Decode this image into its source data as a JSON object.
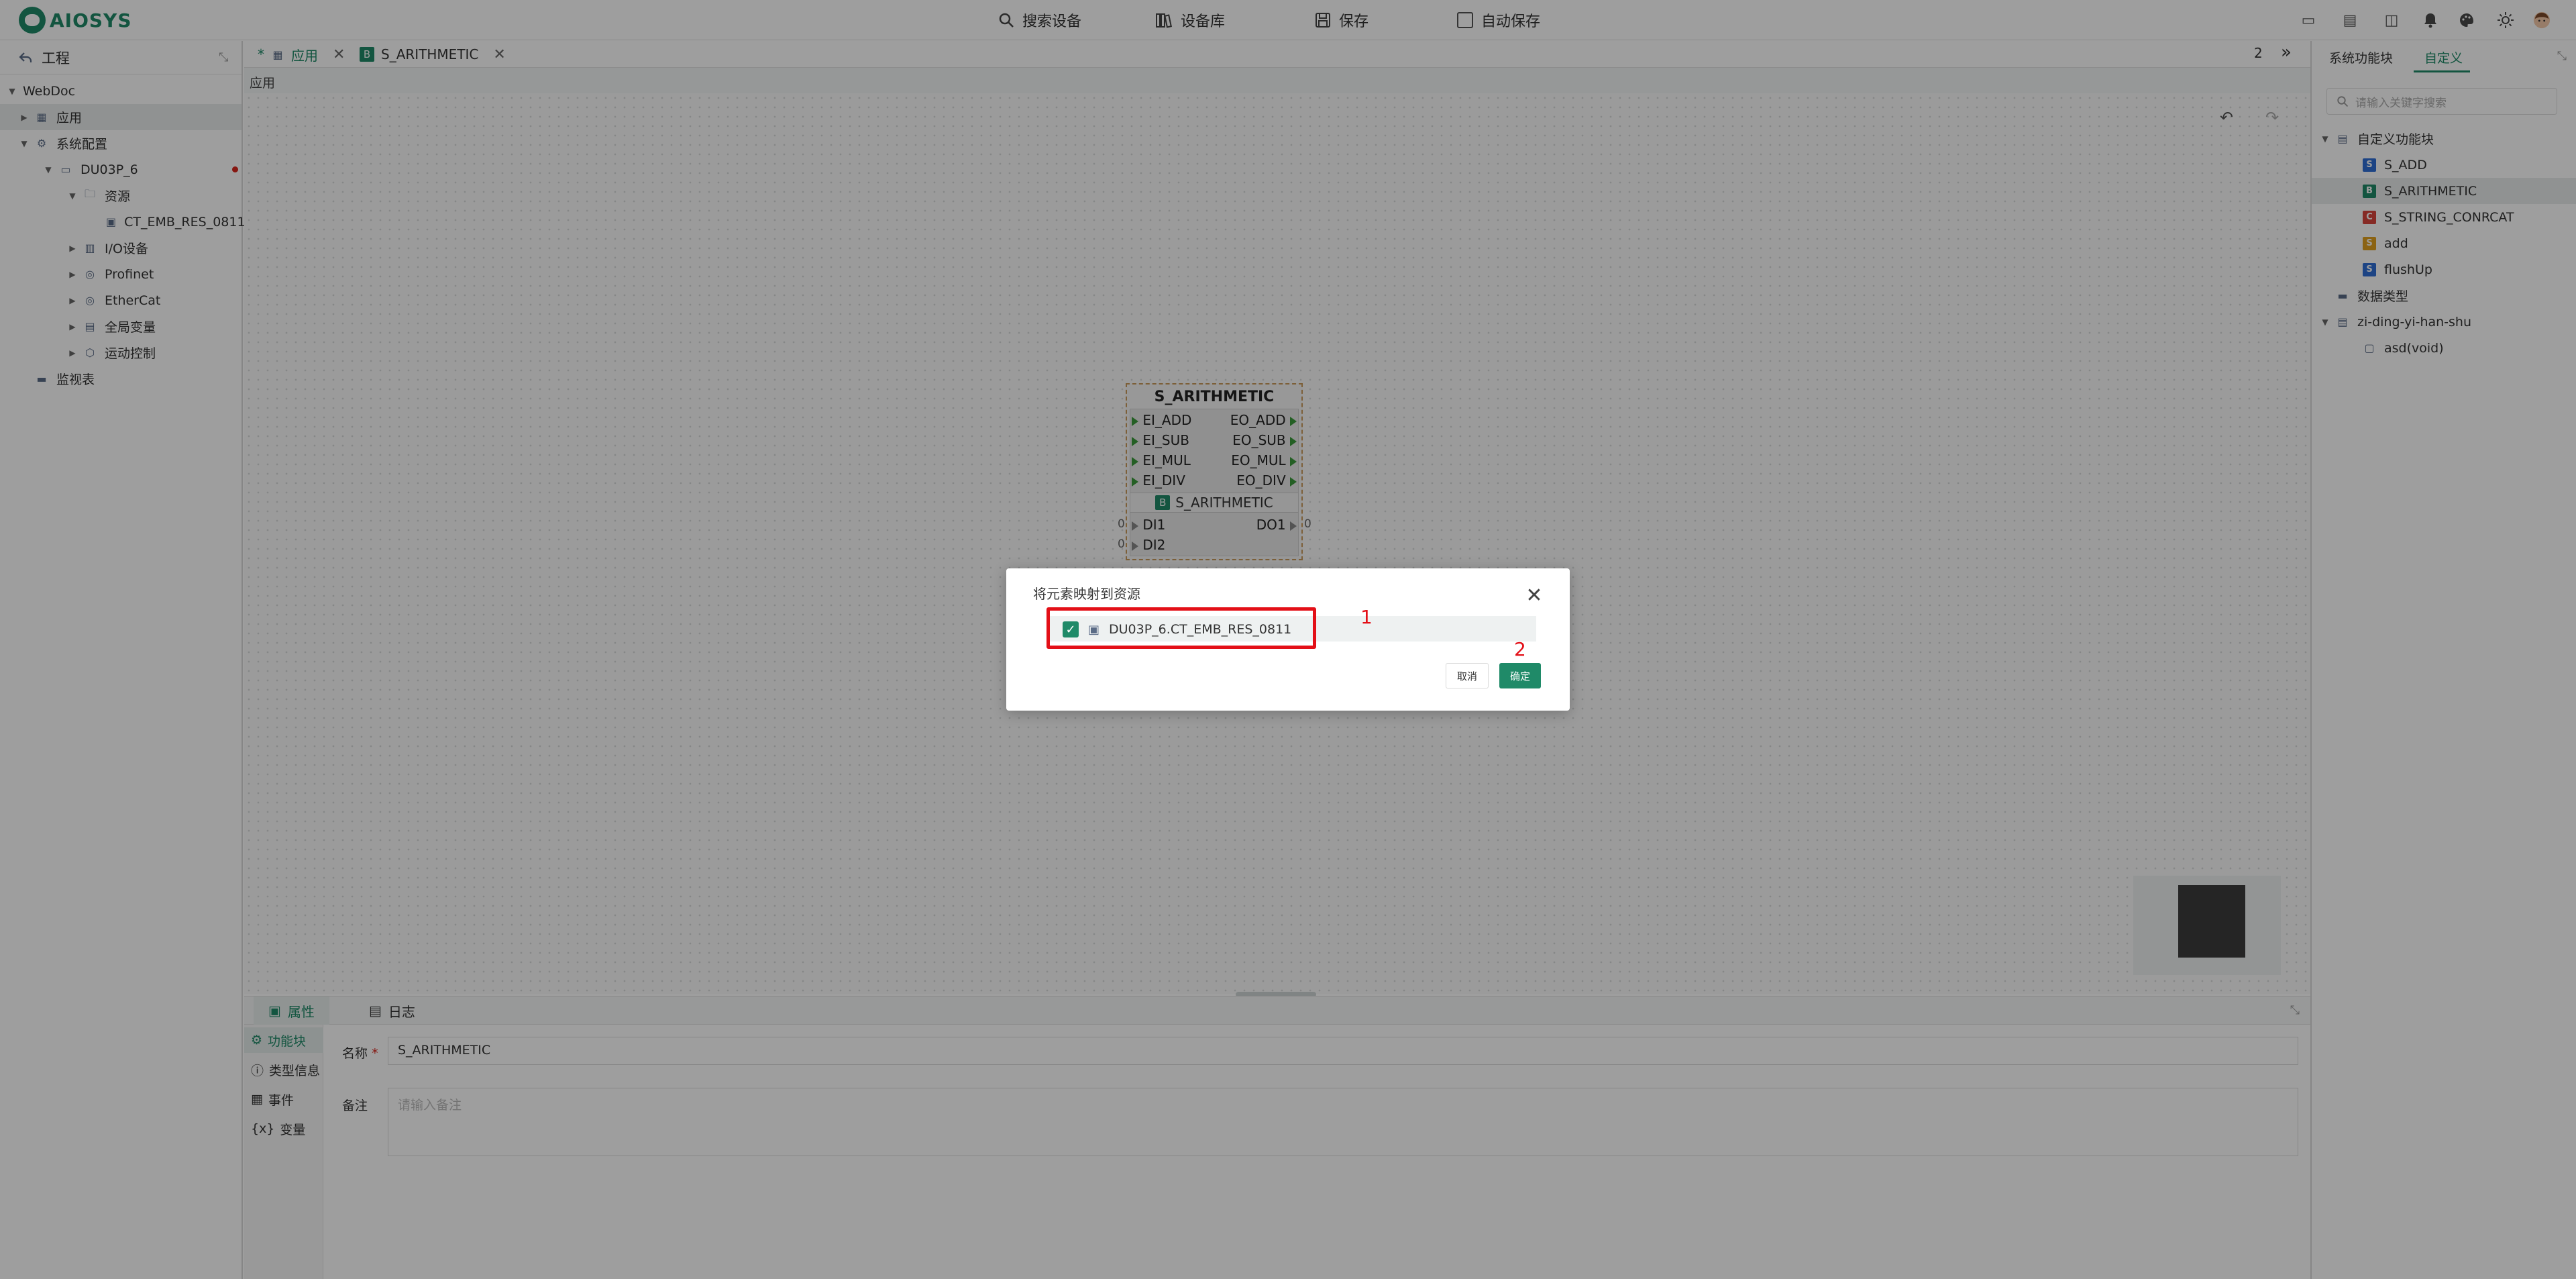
{
  "app": {
    "logo_text": "AIOSYS",
    "brand_color": "#1f8a68"
  },
  "toolbar": {
    "search_devices": "搜索设备",
    "device_library": "设备库",
    "save": "保存",
    "auto_save": "自动保存"
  },
  "left_panel": {
    "header": "工程",
    "tree": [
      {
        "label": "WebDoc"
      },
      {
        "label": "应用"
      },
      {
        "label": "系统配置"
      },
      {
        "label": "DU03P_6"
      },
      {
        "label": "资源"
      },
      {
        "label": "CT_EMB_RES_0811"
      },
      {
        "label": "I/O设备"
      },
      {
        "label": "Profinet"
      },
      {
        "label": "EtherCat"
      },
      {
        "label": "全局变量"
      },
      {
        "label": "运动控制"
      },
      {
        "label": "监视表"
      }
    ]
  },
  "tabs": [
    {
      "label": "应用",
      "modified": "*"
    },
    {
      "label": "S_ARITHMETIC"
    }
  ],
  "tab_count": "2",
  "breadcrumb": "应用",
  "function_block": {
    "title": "S_ARITHMETIC",
    "event_inputs": [
      "EI_ADD",
      "EI_SUB",
      "EI_MUL",
      "EI_DIV"
    ],
    "event_outputs": [
      "EO_ADD",
      "EO_SUB",
      "EO_MUL",
      "EO_DIV"
    ],
    "type_label": "S_ARITHMETIC",
    "data_inputs": [
      "DI1",
      "DI2"
    ],
    "data_outputs": [
      "DO1"
    ],
    "input_values": [
      "0",
      "0"
    ],
    "output_values": [
      "0"
    ]
  },
  "bottom_panel": {
    "tabs": [
      "属性",
      "日志"
    ],
    "menu": [
      "功能块",
      "类型信息",
      "事件",
      "变量"
    ],
    "name_label": "名称",
    "required_mark": "*",
    "name_value": "S_ARITHMETIC",
    "note_label": "备注",
    "note_placeholder": "请输入备注"
  },
  "right_panel": {
    "tabs": [
      "系统功能块",
      "自定义"
    ],
    "search_placeholder": "请输入关键字搜索",
    "tree": [
      {
        "label": "自定义功能块"
      },
      {
        "label": "S_ADD",
        "badge": "S",
        "color": "#2f6fd6"
      },
      {
        "label": "S_ARITHMETIC",
        "badge": "B",
        "color": "#1f8a68"
      },
      {
        "label": "S_STRING_CONRCAT",
        "badge": "C",
        "color": "#d9453c"
      },
      {
        "label": "add",
        "badge": "S",
        "color": "#e0a020"
      },
      {
        "label": "flushUp",
        "badge": "S",
        "color": "#2f6fd6"
      },
      {
        "label": "数据类型"
      },
      {
        "label": "zi-ding-yi-han-shu"
      },
      {
        "label": "asd(void)"
      }
    ]
  },
  "dialog": {
    "title": "将元素映射到资源",
    "item_label": "DU03P_6.CT_EMB_RES_0811",
    "cancel": "取消",
    "confirm": "确定",
    "annotation_1": "1",
    "annotation_2": "2"
  }
}
